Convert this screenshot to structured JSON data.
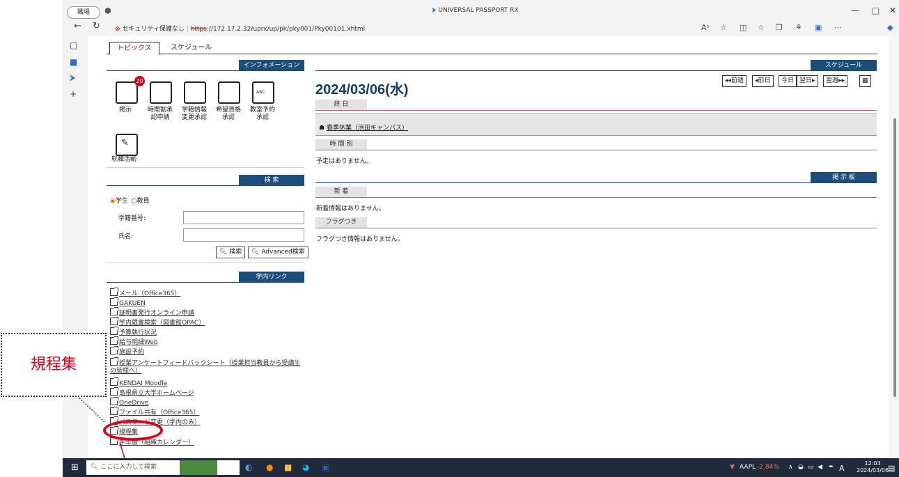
{
  "browser": {
    "profile_label": "職場",
    "page_title": "UNIVERSAL PASSPORT RX",
    "security_label": "セキュリティ保護なし",
    "url_https": "https",
    "url_rest": "://172.17.2.32/uprx/up/pk/pky001/Pky00101.xhtml",
    "minimize": "—",
    "restore": "□",
    "close": "✕"
  },
  "tabs": [
    {
      "label": "トピックス",
      "active": true
    },
    {
      "label": "スケジュール",
      "active": false
    }
  ],
  "information": {
    "header": "インフォメーション",
    "items": [
      {
        "label": "掲示",
        "badge": "20"
      },
      {
        "label": "時間割承\n認申請"
      },
      {
        "label": "学籍情報\n変更承認"
      },
      {
        "label": "希望資格\n承認"
      },
      {
        "label": "教室予約\n承認"
      },
      {
        "label": "就職活動"
      }
    ]
  },
  "search": {
    "header": "検 索",
    "radio_student": "学生",
    "radio_teacher": "教員",
    "student_no_label": "学籍番号:",
    "name_label": "氏名:",
    "search_button": "検索",
    "advanced_button": "Advanced検索"
  },
  "links": {
    "header": "学内リンク",
    "items": [
      "メール（Office365）",
      "GAKUEN",
      "証明書発行オンライン申請",
      "学内蔵書検索（図書館OPAC）",
      "予算執行状況",
      "給与明細Web",
      "施設予約",
      "授業アンケートフィードバックシート（授業担当教員から受講生",
      "の皆様へ）",
      "KENDAI Moodle",
      "島根県立大学ホームページ",
      "OneDrive",
      "ファイル共有（Office365）",
      "パスワード変更（学内のみ）",
      "規程集",
      "学年暦（組織カレンダー）"
    ]
  },
  "schedule": {
    "header": "スケジュール",
    "date": "2024/03/06(水)",
    "nav": [
      "◂◂前週",
      "◂前日",
      "今日",
      "翌日▸",
      "翌週▸▸"
    ],
    "all_day_label": "終 日",
    "all_day_event": "春季休業（浜田キャンパス）",
    "timed_label": "時 間 別",
    "no_schedule": "予定はありません。"
  },
  "board": {
    "header": "掲 示 板",
    "new_label": "新 着",
    "new_empty": "新着情報はありません。",
    "flag_label": "フラグつき",
    "flag_empty": "フラグつき情報はありません。"
  },
  "annotation": {
    "callout": "規程集"
  },
  "taskbar": {
    "search_placeholder": "ここに入力して検索",
    "stock_name": "AAPL",
    "stock_change": "-2.84%",
    "ime": "A",
    "time": "12:03",
    "date": "2024/03/06"
  }
}
